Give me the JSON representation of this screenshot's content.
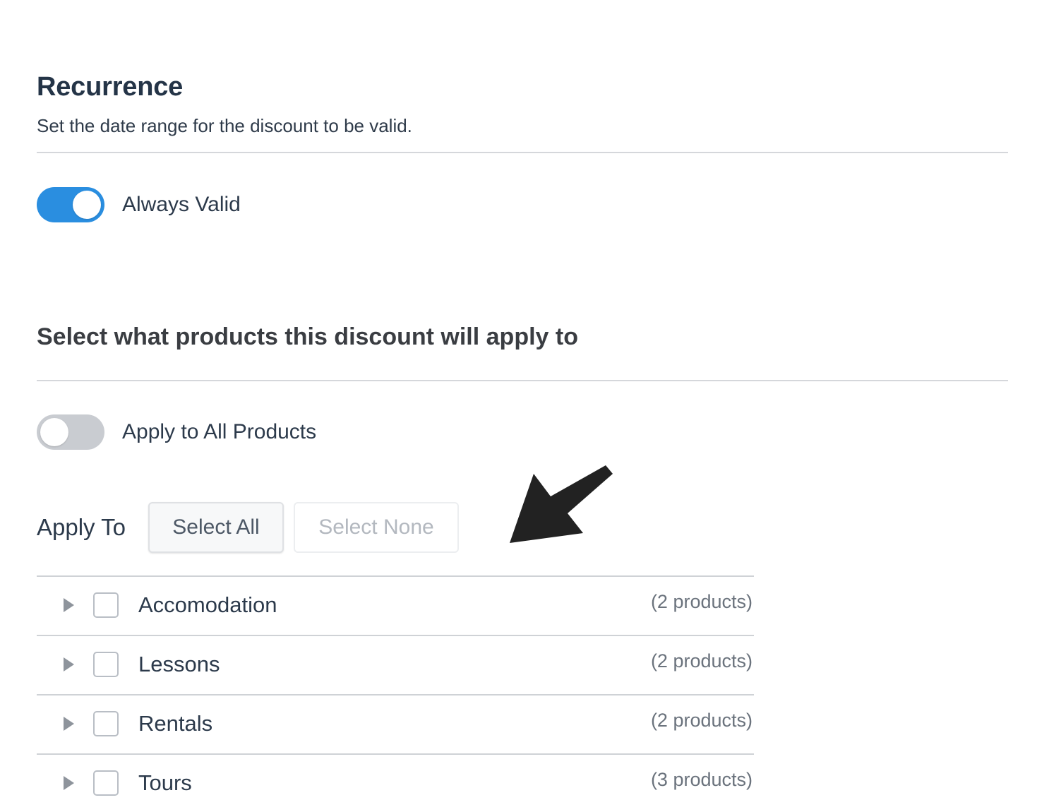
{
  "recurrence": {
    "title": "Recurrence",
    "subtitle": "Set the date range for the discount to be valid.",
    "always_valid": {
      "label": "Always Valid",
      "enabled": true
    }
  },
  "products": {
    "title": "Select what products this discount will apply to",
    "apply_all": {
      "label": "Apply to All Products",
      "enabled": false
    },
    "apply_to_label": "Apply To",
    "select_all_label": "Select All",
    "select_none_label": "Select None",
    "categories": [
      {
        "name": "Accomodation",
        "count": "(2 products)"
      },
      {
        "name": "Lessons",
        "count": "(2 products)"
      },
      {
        "name": "Rentals",
        "count": "(2 products)"
      },
      {
        "name": "Tours",
        "count": "(3 products)"
      }
    ]
  },
  "colors": {
    "toggle_on": "#2a8ee0",
    "toggle_off": "#c9ccd1",
    "heading": "#243447",
    "annotation_arrow": "#222222"
  },
  "icons": {
    "expand": "caret-right-icon",
    "annotation": "arrow-annotation-icon"
  }
}
